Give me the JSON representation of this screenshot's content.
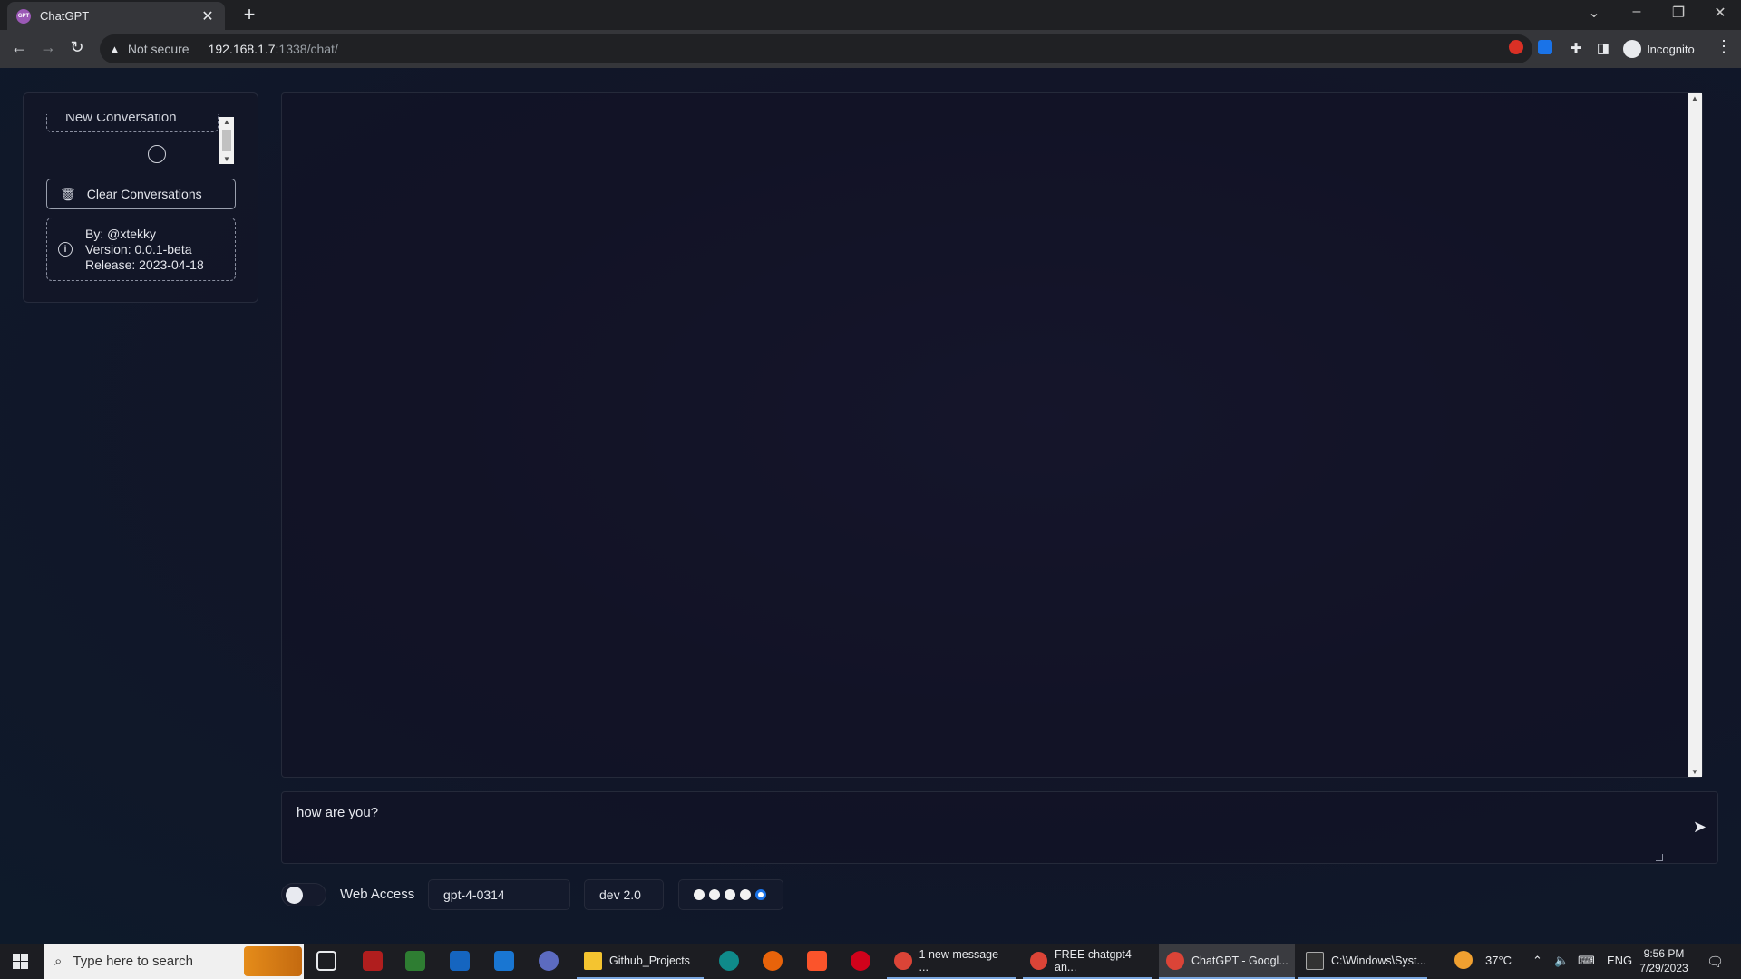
{
  "browser": {
    "tab_title": "ChatGPT",
    "tab_favicon_text": "GPT",
    "security_label": "Not secure",
    "url_host": "192.168.1.7",
    "url_rest": ":1338/chat/",
    "profile_label": "Incognito"
  },
  "sidebar": {
    "new_conversation_label": "New Conversation",
    "clear_label": "Clear Conversations",
    "info": {
      "by": "By: @xtekky",
      "version": "Version: 0.0.1-beta",
      "release": "Release: 2023-04-18"
    }
  },
  "chat": {
    "input_value": "how are you?"
  },
  "controls": {
    "web_access_label": "Web Access",
    "web_access_enabled": false,
    "model_selected": "gpt-4-0314",
    "jailbreak_selected": "dev 2.0",
    "style_options_count": 5,
    "style_selected_index": 4
  },
  "taskbar": {
    "search_placeholder": "Type here to search",
    "items": [
      {
        "label": "Github_Projects"
      },
      {
        "label": "1 new message - ..."
      },
      {
        "label": "FREE chatgpt4 an..."
      },
      {
        "label": "ChatGPT - Googl..."
      },
      {
        "label": "C:\\Windows\\Syst..."
      }
    ],
    "weather": "37°C",
    "language": "ENG",
    "time": "9:56 PM",
    "date": "7/29/2023"
  },
  "colors": {
    "page_bg": "#121528",
    "accent_dot": "#1a73e8",
    "taskbar_bg": "#1c1d22"
  }
}
